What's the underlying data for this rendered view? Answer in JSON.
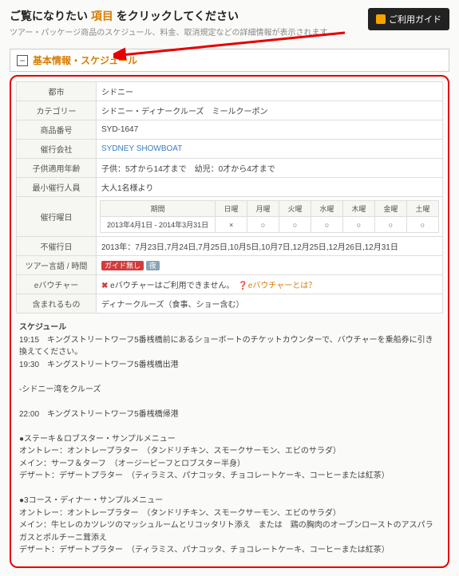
{
  "header": {
    "title_prefix": "ご覧になりたい ",
    "title_highlight": "項目",
    "title_suffix": " をクリックしてください",
    "subtitle": "ツアー・パッケージ商品のスケジュール、料金、取消規定などの詳細情報が表示されます。",
    "guide_btn": "ご利用ガイド"
  },
  "section": {
    "title": "基本情報・スケジュール"
  },
  "rows": {
    "city_label": "都市",
    "city_val": "シドニー",
    "category_label": "カテゴリー",
    "category_val": "シドニー・ディナークルーズ　ミールクーポン",
    "prodno_label": "商品番号",
    "prodno_val": "SYD-1647",
    "operator_label": "催行会社",
    "operator_val": "SYDNEY SHOWBOAT",
    "childage_label": "子供適用年齢",
    "childage_val": "子供：5才から14才まで　幼児：0才から4才まで",
    "minpax_label": "最小催行人員",
    "minpax_val": "大人1名様より",
    "opday_label": "催行曜日",
    "period_h": "期間",
    "sun_h": "日曜",
    "mon_h": "月曜",
    "tue_h": "火曜",
    "wed_h": "水曜",
    "thu_h": "木曜",
    "fri_h": "金曜",
    "sat_h": "土曜",
    "period_val": "2013年4月1日 - 2014年3月31日",
    "sun_v": "×",
    "mon_v": "○",
    "tue_v": "○",
    "wed_v": "○",
    "thu_v": "○",
    "fri_v": "○",
    "sat_v": "○",
    "noop_label": "不催行日",
    "noop_val": "2013年：7月23日,7月24日,7月25日,10月5日,10月7日,12月25日,12月26日,12月31日",
    "lang_label": "ツアー言語 / 時間",
    "badge_red": "ガイド無し",
    "badge_gray": "夜",
    "evoucher_label": "eバウチャー",
    "evoucher_x": "✖",
    "evoucher_txt": " eバウチャーはご利用できません。",
    "evoucher_q": "eバウチャーとは？",
    "included_label": "含まれるもの",
    "included_val": "ディナークルーズ（食事、ショー含む）"
  },
  "schedule": {
    "heading": "スケジュール",
    "l1": "19:15　キングストリートワーフ5番桟橋前にあるショーボートのチケットカウンターで、バウチャーを乗船券に引き換えてください。",
    "l2": "19:30　キングストリートワーフ5番桟橋出港",
    "gap1": "",
    "l3": "-シドニー湾をクルーズ",
    "gap2": "",
    "l4": "22:00　キングストリートワーフ5番桟橋帰港",
    "gap3": "",
    "m1h": "●ステーキ＆ロブスター・サンプルメニュー",
    "m1a": "オントレー：オントレープラター　（タンドリチキン、スモークサーモン、エビのサラダ）",
    "m1b": "メイン：サーフ＆ターフ　（オージービーフとロブスター半身）",
    "m1c": "デザート：デザートプラター　（ティラミス、パナコッタ、チョコレートケーキ、コーヒーまたは紅茶）",
    "gap4": "",
    "m2h": "●3コース・ディナー・サンプルメニュー",
    "m2a": "オントレー：オントレープラター　（タンドリチキン、スモークサーモン、エビのサラダ）",
    "m2b": "メイン：牛ヒレのカツレツのマッシュルームとリコッタリト添え　または　鶏の胸肉のオーブンローストのアスパラガスとポルチーニ茸添え",
    "m2c": "デザート：デザートプラター　（ティラミス、パナコッタ、チョコレートケーキ、コーヒーまたは紅茶）"
  }
}
